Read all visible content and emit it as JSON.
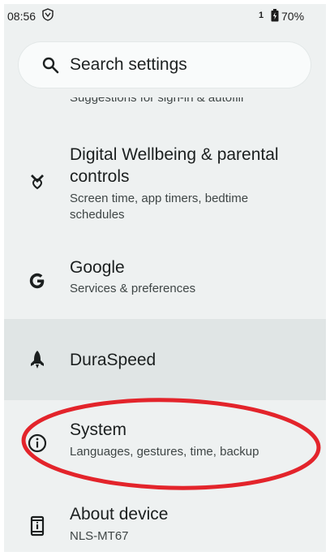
{
  "status_bar": {
    "time": "08:56",
    "sim_indicator": "1",
    "battery_percent": "70%",
    "icons": [
      "vpn-shield-icon",
      "battery-icon"
    ]
  },
  "search": {
    "placeholder": "Search settings",
    "icon": "search-icon"
  },
  "previous_item_subtitle_cropped": "Suggestions for sign-in & autofill",
  "items": [
    {
      "title": "Digital Wellbeing & parental controls",
      "subtitle": "Screen time, app timers, bedtime schedules",
      "icon": "digital-wellbeing-icon"
    },
    {
      "title": "Google",
      "subtitle": "Services & preferences",
      "icon": "google-g-icon"
    },
    {
      "title": "DuraSpeed",
      "subtitle": "",
      "icon": "rocket-icon",
      "highlighted": true
    },
    {
      "title": "System",
      "subtitle": "Languages, gestures, time, backup",
      "icon": "info-icon",
      "annotated": true
    },
    {
      "title": "About device",
      "subtitle": "NLS-MT67",
      "icon": "phone-device-icon"
    }
  ],
  "colors": {
    "background": "#eef1f1",
    "highlight_row": "#e0e5e5",
    "annotation_circle": "#e3242b",
    "text_primary": "#1b1f1f",
    "text_secondary": "#3f4646"
  }
}
